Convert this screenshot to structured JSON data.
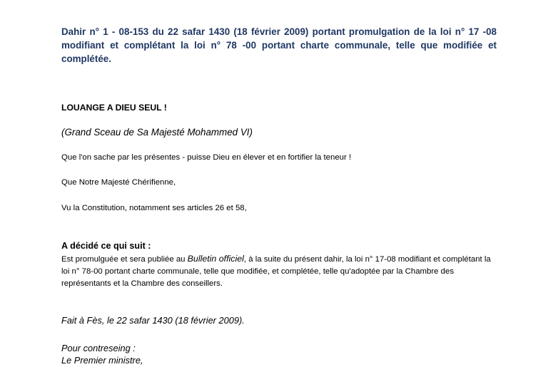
{
  "document": {
    "title": "Dahir n° 1 - 08-153 du 22 safar 1430 (18 février 2009) portant promulgation de la loi n° 17 -08 modifiant et complétant la loi n° 78 -00 portant charte communale, telle que modifiée et complétée.",
    "louange": "LOUANGE A DIEU SEUL !",
    "sceau": "(Grand Sceau de Sa Majesté Mohammed VI)",
    "paragraphs": [
      "Que l'on sache par les présentes - puisse Dieu en élever et en fortifier la teneur !",
      "Que Notre Majesté Chérifienne,",
      "Vu la Constitution, notamment ses articles 26 et 58,"
    ],
    "decide_heading": "A décidé ce qui suit :",
    "decision": {
      "before": "Est promulguée et sera publiée au ",
      "italic": "Bulletin officiel",
      "after": ", à la suite du présent dahir, la loi n° 17-08 modifiant et complétant la loi n° 78-00 portant charte communale, telle que modifiée, et complétée, telle qu'adoptée par la Chambre des représentants et la Chambre des conseillers."
    },
    "fait": "Fait à Fès, le 22 safar 1430 (18 février 2009).",
    "contreseing": "Pour contreseing :",
    "signataire": "Le Premier ministre,"
  },
  "colors": {
    "title": "#1f3763",
    "text": "#000000",
    "background": "#ffffff"
  }
}
